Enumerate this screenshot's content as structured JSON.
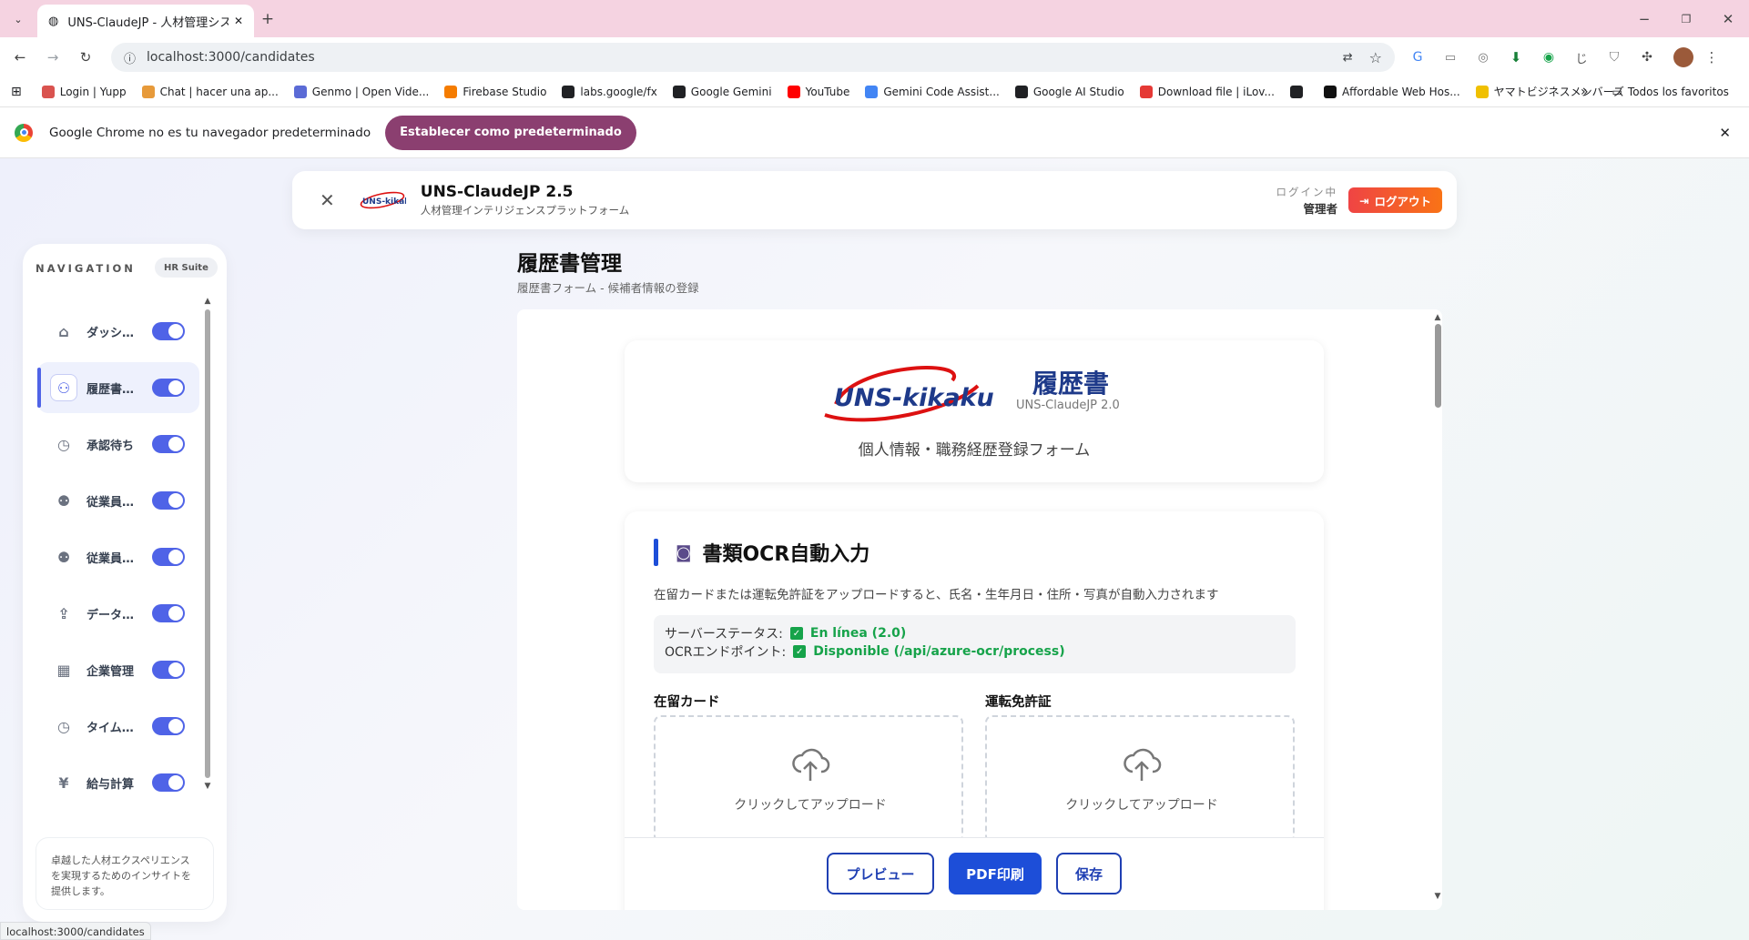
{
  "browser": {
    "tab_title": "UNS-ClaudeJP - 人材管理システム",
    "url": "localhost:3000/candidates",
    "bookmarks": [
      {
        "label": "Login | Yupp",
        "color": "#d9534f"
      },
      {
        "label": "Chat | hacer una ap...",
        "color": "#e79a3a"
      },
      {
        "label": "Genmo | Open Vide...",
        "color": "#5b6bd6"
      },
      {
        "label": "Firebase Studio",
        "color": "#f57c00"
      },
      {
        "label": "labs.google/fx",
        "color": "#202124"
      },
      {
        "label": "Google Gemini",
        "color": "#202124"
      },
      {
        "label": "YouTube",
        "color": "#ff0000"
      },
      {
        "label": "Gemini Code Assist...",
        "color": "#4285f4"
      },
      {
        "label": "Google AI Studio",
        "color": "#202124"
      },
      {
        "label": "Download file | iLov...",
        "color": "#e53935"
      },
      {
        "label": "",
        "color": "#202124"
      },
      {
        "label": "Affordable Web Hos...",
        "color": "#111111"
      },
      {
        "label": "ヤマトビジネスメンバーズ",
        "color": "#f0c000"
      }
    ],
    "all_bookmarks": "Todos los favoritos",
    "infobar_text": "Google Chrome no es tu navegador predeterminado",
    "infobar_button": "Establecer como predeterminado",
    "status_url": "localhost:3000/candidates"
  },
  "header": {
    "app_title": "UNS-ClaudeJP 2.5",
    "app_subtitle": "人材管理インテリジェンスプラットフォーム",
    "login_status": "ログイン中",
    "user_role": "管理者",
    "logout_label": "ログアウト"
  },
  "sidebar": {
    "heading": "NAVIGATION",
    "badge": "HR Suite",
    "items": [
      {
        "label": "ダッシュボード",
        "icon": "home-icon",
        "glyph": "⌂",
        "active": false
      },
      {
        "label": "履歴書管理",
        "icon": "user-plus-icon",
        "glyph": "⚇",
        "active": true
      },
      {
        "label": "承認待ち",
        "icon": "clock-icon",
        "glyph": "◷",
        "active": false
      },
      {
        "label": "従業員管理",
        "icon": "users-icon",
        "glyph": "⚉",
        "active": false
      },
      {
        "label": "従業員一覧",
        "icon": "users-icon",
        "glyph": "⚉",
        "active": false
      },
      {
        "label": "データ入力",
        "icon": "upload-icon",
        "glyph": "⇪",
        "active": false
      },
      {
        "label": "企業管理",
        "icon": "building-icon",
        "glyph": "▦",
        "active": false
      },
      {
        "label": "タイムカード",
        "icon": "clock-icon",
        "glyph": "◷",
        "active": false
      },
      {
        "label": "給与計算",
        "icon": "yen-icon",
        "glyph": "¥",
        "active": false
      }
    ],
    "footer_text": "卓越した人材エクスペリエンスを実現するためのインサイトを提供します。"
  },
  "page": {
    "title": "履歴書管理",
    "subtitle": "履歴書フォーム - 候補者情報の登録"
  },
  "form": {
    "logo_text": "UNS-kikaku",
    "doc_title": "履歴書",
    "doc_version": "UNS-ClaudeJP 2.0",
    "doc_subtitle": "個人情報・職務経歴登録フォーム",
    "ocr": {
      "icon": "camera-icon",
      "title": "書類OCR自動入力",
      "description": "在留カードまたは運転免許証をアップロードすると、氏名・生年月日・住所・写真が自動入力されます",
      "server_status_label": "サーバーステータス:",
      "server_status_value": "En línea (2.0)",
      "endpoint_label": "OCRエンドポイント:",
      "endpoint_value": "Disponible (/api/azure-ocr/process)",
      "status_color": "#16a34a",
      "residence_card_label": "在留カード",
      "license_label": "運転免許証",
      "upload_text": "クリックしてアップロード"
    },
    "actions": {
      "preview": "プレビュー",
      "print": "PDF印刷",
      "save": "保存"
    }
  },
  "colors": {
    "accent": "#4f63e7",
    "primary_button": "#1d4ed8",
    "logout": "#f97316",
    "chrome_pink": "#f5d3e1",
    "infobar_button": "#8b3f70"
  }
}
